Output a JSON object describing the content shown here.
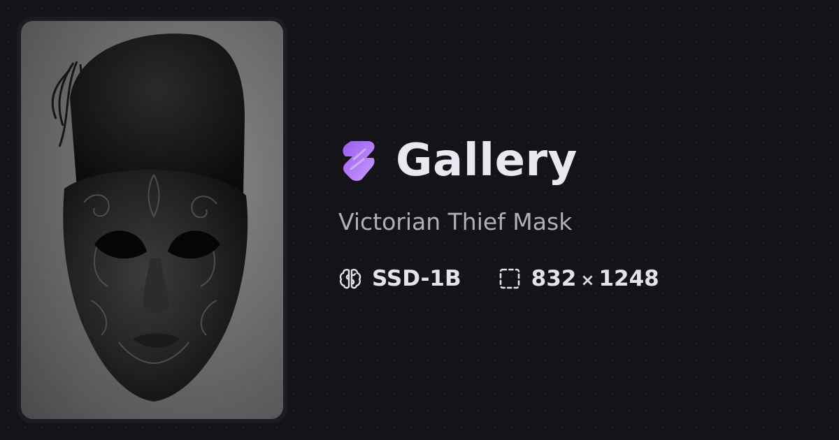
{
  "header": {
    "app_title": "Gallery",
    "logo_icon": "stability-logo-icon",
    "accent_color": "#a974f5"
  },
  "artwork": {
    "title": "Victorian Thief Mask",
    "image_description": "black ornate filigree masquerade mask with cloth hood on grey background",
    "model_icon": "brain-icon",
    "model": "SSD-1B",
    "dimensions_icon": "dashed-frame-icon",
    "width": "832",
    "times": "×",
    "height": "1248"
  }
}
